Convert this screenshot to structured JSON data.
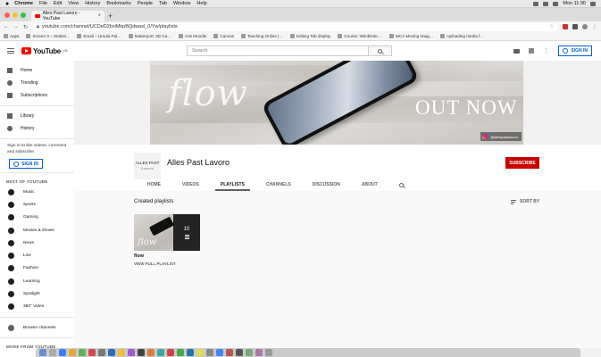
{
  "menubar": {
    "app": "Chrome",
    "items": [
      "File",
      "Edit",
      "View",
      "History",
      "Bookmarks",
      "People",
      "Tab",
      "Window",
      "Help"
    ],
    "clock": "Mon 11:30"
  },
  "browser": {
    "tab_title": "Alles Past Lavoro - YouTube",
    "url": "youtube.com/channel/UCDeD2bxiMkpBQdwasl_0/Yw/playlists",
    "bookmarks": [
      "Apps",
      "Screen 0 – Statisti…",
      "Email – Ursula Pal…",
      "Matterport: 3D Ca…",
      "Arts Moodle",
      "Canvas",
      "Teaching Online |…",
      "Editing Tab display",
      "Course: Wimbledo…",
      "WCA Moving Imag…",
      "Uploading media f…"
    ]
  },
  "masthead": {
    "logo_text": "YouTube",
    "logo_region": "GB",
    "search_placeholder": "Search",
    "signin_label": "SIGN IN"
  },
  "sidebar": {
    "primary": [
      "Home",
      "Trending",
      "Subscriptions"
    ],
    "secondary": [
      "Library",
      "History"
    ],
    "signin_prompt": "Sign in to like videos, comment and subscribe.",
    "signin_label": "SIGN IN",
    "best_heading": "BEST OF YOUTUBE",
    "best_items": [
      "Music",
      "Sports",
      "Gaming",
      "Movies & shows",
      "News",
      "Live",
      "Fashion",
      "Learning",
      "Spotlight",
      "360° Video"
    ],
    "browse_channels": "Browse channels",
    "more_heading": "MORE FROM YOUTUBE"
  },
  "banner": {
    "script_text": "flow",
    "headline": "OUT NOW",
    "social_handle": "@allespastlavoro"
  },
  "channel": {
    "avatar_line1": "ALLES PAST",
    "avatar_line2": "Lavoro",
    "name": "Alles Past Lavoro",
    "subscribe_label": "SUBSCRIBE",
    "tabs": [
      "HOME",
      "VIDEOS",
      "PLAYLISTS",
      "CHANNELS",
      "DISCUSSION",
      "ABOUT"
    ],
    "active_tab": "PLAYLISTS"
  },
  "playlists": {
    "heading": "Created playlists",
    "sort_label": "SORT BY",
    "items": [
      {
        "title": "flow",
        "video_count": "10",
        "thumb_text": "flow",
        "link_label": "VIEW FULL PLAYLIST"
      }
    ]
  },
  "colors": {
    "brand_red": "#ff0000",
    "subscribe_red": "#cc0000",
    "link_blue": "#065fd4"
  }
}
